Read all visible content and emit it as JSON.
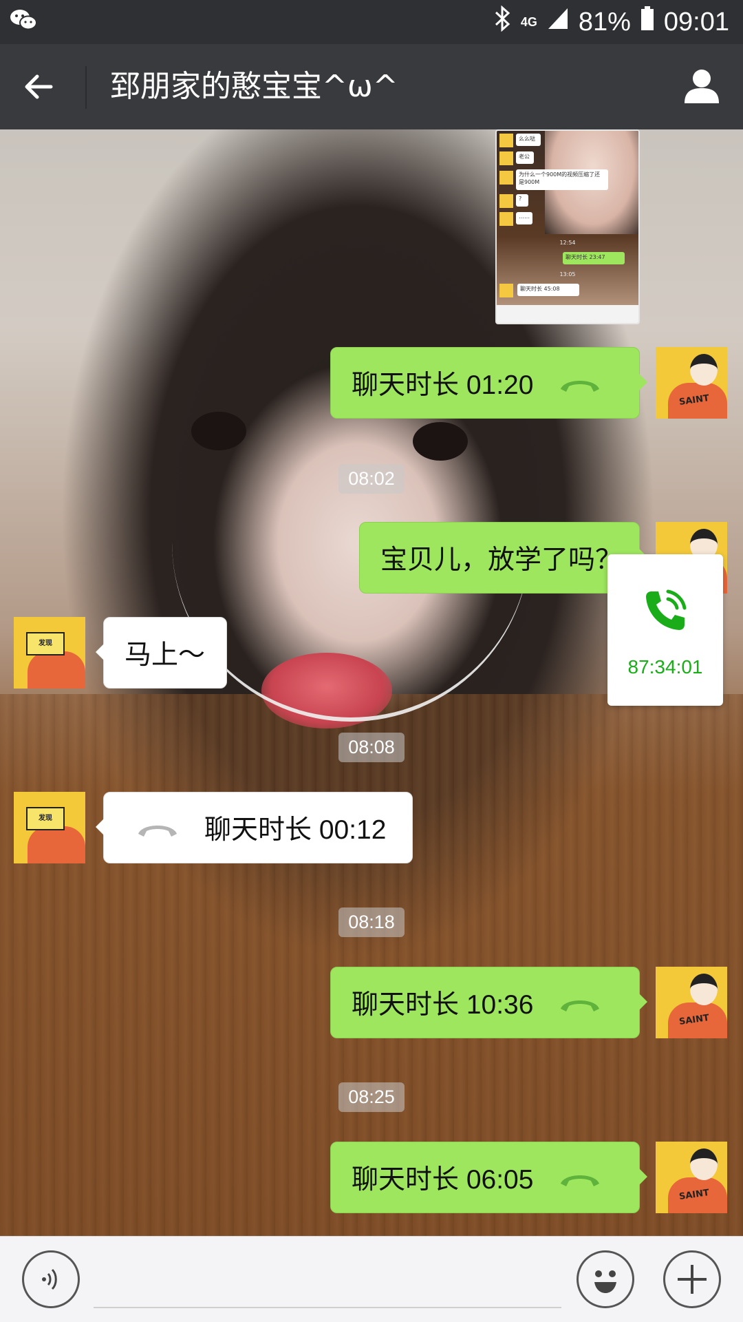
{
  "status_bar": {
    "network": "4G",
    "battery": "81%",
    "time": "09:01",
    "icons": [
      "wechat-icon",
      "bluetooth-icon",
      "signal-icon",
      "battery-icon"
    ]
  },
  "header": {
    "title": "郅朋家的憨宝宝^ω^",
    "back_icon": "arrow-left-icon",
    "profile_icon": "person-icon"
  },
  "messages": {
    "m1": {
      "sender": "self",
      "label": "聊天时长 01:20",
      "type": "call"
    },
    "ts1": "08:02",
    "m2": {
      "sender": "self",
      "label": "宝贝儿，放学了吗？",
      "type": "text"
    },
    "m3": {
      "sender": "other",
      "label": "马上～",
      "type": "text"
    },
    "ts2": "08:08",
    "m4": {
      "sender": "other",
      "label": "聊天时长 00:12",
      "type": "call"
    },
    "ts3": "08:18",
    "m5": {
      "sender": "self",
      "label": "聊天时长 10:36",
      "type": "call"
    },
    "ts4": "08:25",
    "m6": {
      "sender": "self",
      "label": "聊天时长 06:05",
      "type": "call"
    }
  },
  "image_message": {
    "mini_texts": [
      "么么哒",
      "老公",
      "为什么一个900M的视频压缩了还是900M",
      "?",
      "……",
      "12:54",
      "聊天时长 23:47",
      "13:05",
      "聊天时长 45:08"
    ]
  },
  "call_widget": {
    "duration": "87:34:01",
    "icon": "phone-call-icon",
    "color": "#1aad19"
  },
  "input_bar": {
    "voice_icon": "voice-icon",
    "emoji_icon": "emoji-icon",
    "plus_icon": "plus-icon"
  },
  "colors": {
    "bubble_self": "#9ee65e",
    "bubble_other": "#ffffff",
    "header_bg": "#393a3e",
    "statusbar_bg": "#2f3033"
  }
}
